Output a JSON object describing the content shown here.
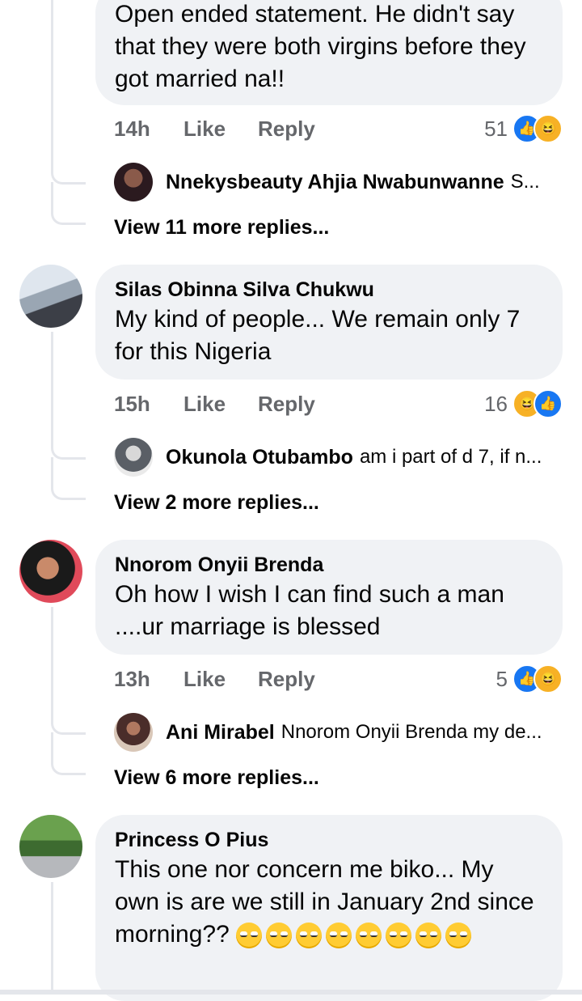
{
  "comments": [
    {
      "author": "",
      "text": "Open ended statement. He  didn't say that they were both virgins before they got married na!!",
      "time": "14h",
      "like": "Like",
      "reply": "Reply",
      "count": "51",
      "reactions": [
        "like-icon",
        "haha-icon"
      ],
      "reply_preview": {
        "name": "Nnekysbeauty Ahjia Nwabunwanne",
        "snippet": "S..."
      },
      "more_replies": "View 11 more replies..."
    },
    {
      "author": "Silas Obinna Silva Chukwu",
      "text": "My kind of people... We remain only 7 for this Nigeria",
      "time": "15h",
      "like": "Like",
      "reply": "Reply",
      "count": "16",
      "reactions": [
        "haha-icon",
        "like-icon"
      ],
      "reply_preview": {
        "name": "Okunola Otubambo",
        "snippet": "am i part of d 7, if n..."
      },
      "more_replies": "View 2 more replies..."
    },
    {
      "author": "Nnorom Onyii Brenda",
      "text": "Oh how I wish I can find such a man ....ur marriage is blessed",
      "time": "13h",
      "like": "Like",
      "reply": "Reply",
      "count": "5",
      "reactions": [
        "like-icon",
        "haha-icon"
      ],
      "reply_preview": {
        "name": "Ani Mirabel",
        "snippet": "Nnorom Onyii Brenda my de..."
      },
      "more_replies": "View 6 more replies..."
    },
    {
      "author": "Princess O Pius",
      "text": "This one nor concern me biko... My own is are we still in January 2nd since morning??",
      "emojis": [
        "unamused-emoji",
        "unamused-emoji",
        "unamused-emoji",
        "eye-roll-emoji",
        "eye-roll-emoji",
        "eye-roll-emoji",
        "eye-roll-emoji",
        "eye-roll-emoji"
      ]
    }
  ],
  "colors": {
    "like_blue": "#1877f2",
    "haha_yellow": "#f7b125",
    "bubble": "#f0f2f5",
    "meta_grey": "#65676b"
  }
}
